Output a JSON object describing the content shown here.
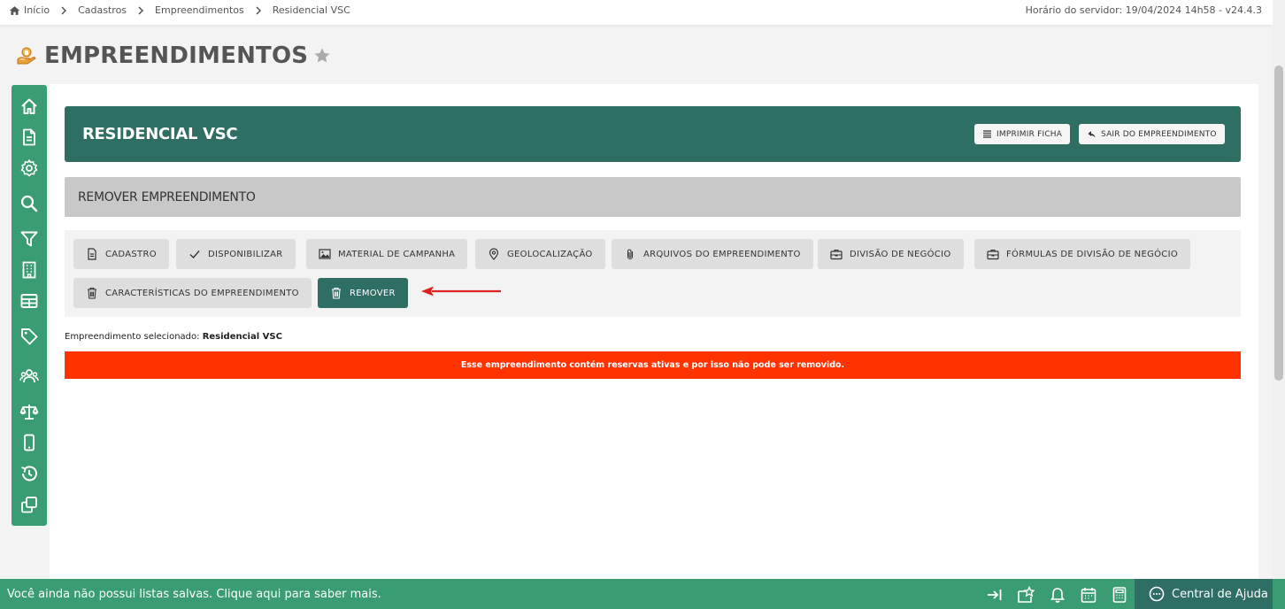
{
  "breadcrumb": {
    "items": [
      "Início",
      "Cadastros",
      "Empreendimentos",
      "Residencial VSC"
    ]
  },
  "server_time": "Horário do servidor: 19/04/2024 14h58 - v24.4.3",
  "page": {
    "title": "EMPREENDIMENTOS"
  },
  "sidebar": {
    "icons": [
      "home-icon",
      "document-icon",
      "gear-icon",
      "search-icon",
      "filter-icon",
      "building-icon",
      "table-icon",
      "tag-icon",
      "users-icon",
      "scale-icon",
      "mobile-icon",
      "history-icon",
      "copy-icon"
    ]
  },
  "header": {
    "title": "RESIDENCIAL VSC",
    "print_label": "IMPRIMIR FICHA",
    "exit_label": "SAIR DO EMPREENDIMENTO"
  },
  "section": {
    "title": "REMOVER EMPREENDIMENTO"
  },
  "actions": [
    {
      "label": "CADASTRO",
      "icon": "document-icon"
    },
    {
      "label": "DISPONIBILIZAR",
      "icon": "check-icon"
    },
    {
      "label": "MATERIAL DE CAMPANHA",
      "icon": "image-icon"
    },
    {
      "label": "GEOLOCALIZAÇÃO",
      "icon": "map-pin-icon"
    },
    {
      "label": "ARQUIVOS DO EMPREENDIMENTO",
      "icon": "paperclip-icon"
    },
    {
      "label": "DIVISÃO DE NEGÓCIO",
      "icon": "briefcase-icon"
    },
    {
      "label": "FÓRMULAS DE DIVISÃO DE NEGÓCIO",
      "icon": "briefcase-icon"
    },
    {
      "label": "CARACTERÍSTICAS DO EMPREENDIMENTO",
      "icon": "trash-icon"
    },
    {
      "label": "REMOVER",
      "icon": "trash-icon",
      "active": true
    }
  ],
  "selected": {
    "label": "Empreendimento selecionado: ",
    "value": "Residencial VSC"
  },
  "alert": {
    "message": "Esse empreendimento contém reservas ativas e por isso não pode ser removido.",
    "color": "#ff3300"
  },
  "bottom": {
    "message": "Você ainda não possui listas salvas. Clique aqui para saber mais.",
    "help_label": "Central de Ajuda"
  },
  "colors": {
    "sidebar": "#3a9c72",
    "header": "#2f6e63",
    "active_button": "#2f6e63"
  }
}
